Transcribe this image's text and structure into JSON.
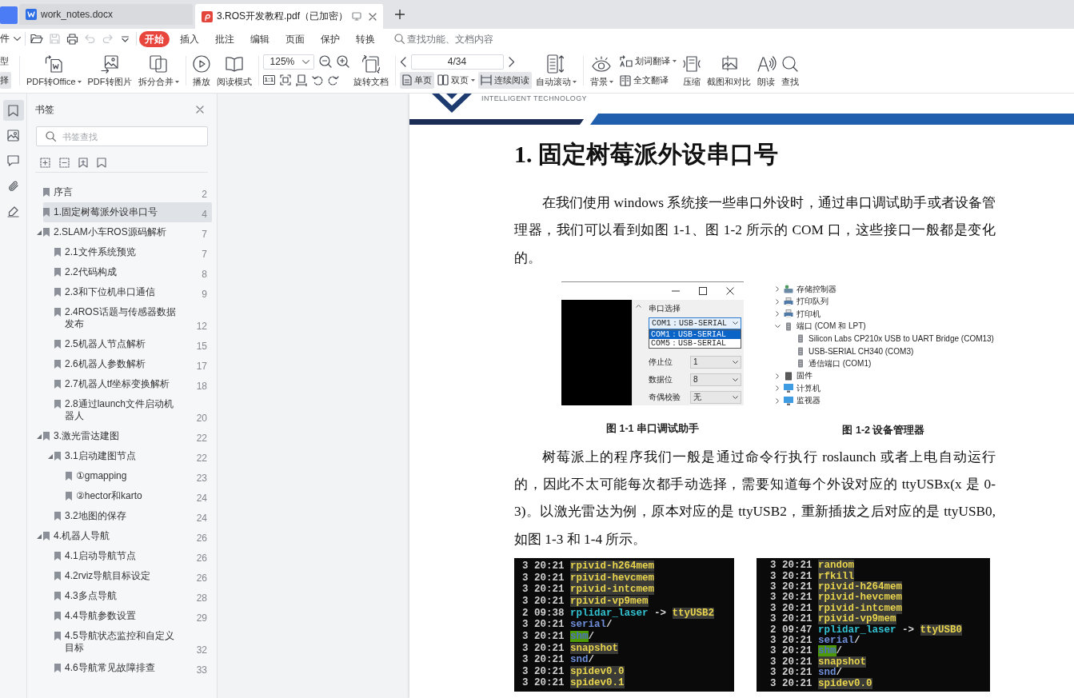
{
  "tabs": [
    {
      "label": "work_notes.docx",
      "kind": "word",
      "selected": false
    },
    {
      "label": "3.ROS开发教程.pdf（已加密）",
      "kind": "pdf",
      "selected": true
    }
  ],
  "menu_bar": {
    "file_menu": "件",
    "quick_access": [
      {
        "disabled": false
      },
      {
        "disabled": true
      },
      {
        "disabled": false
      },
      {
        "disabled": true
      },
      {
        "disabled": true
      },
      {
        "disabled": false
      }
    ],
    "tabs": [
      {
        "label": "开始",
        "selected": true
      },
      {
        "label": "插入",
        "selected": false
      },
      {
        "label": "批注",
        "selected": false
      },
      {
        "label": "编辑",
        "selected": false
      },
      {
        "label": "页面",
        "selected": false
      },
      {
        "label": "保护",
        "selected": false
      },
      {
        "label": "转换",
        "selected": false
      }
    ],
    "search": {
      "placeholder": "查找功能、文档内容"
    }
  },
  "ribbon": {
    "edge_buttons": [
      {
        "label": "型",
        "selected": false
      },
      {
        "label": "择",
        "selected": true
      }
    ],
    "convert": [
      {
        "label": "PDF转Office",
        "dropdown": true
      },
      {
        "label": "PDF转图片",
        "dropdown": false
      },
      {
        "label": "拆分合并",
        "dropdown": true
      }
    ],
    "reading": [
      {
        "label": "播放"
      },
      {
        "label": "阅读模式"
      }
    ],
    "zoom": {
      "value": "125%",
      "actual_size": "1:1"
    },
    "rotate": {
      "label": "旋转文档"
    },
    "page_field": {
      "value": "4/34"
    },
    "view_modes": [
      {
        "label": "单页",
        "selected": true,
        "dropdown": false
      },
      {
        "label": "双页",
        "selected": false,
        "dropdown": true
      },
      {
        "label": "连续阅读",
        "selected": true,
        "dropdown": false
      }
    ],
    "auto_scroll": {
      "label": "自动滚动",
      "dropdown": true
    },
    "tools": [
      {
        "label": "背景",
        "kind": "large",
        "dropdown": true
      },
      {
        "label": "划词翻译",
        "kind": "small",
        "dropdown": true
      },
      {
        "label": "全文翻译",
        "kind": "small",
        "dropdown": false
      },
      {
        "label": "压缩",
        "kind": "large",
        "dropdown": false
      },
      {
        "label": "截图和对比",
        "kind": "large",
        "dropdown": false
      },
      {
        "label": "朗读",
        "kind": "large",
        "dropdown": false
      },
      {
        "label": "查找",
        "kind": "large",
        "dropdown": false
      }
    ]
  },
  "side_rail": [
    {
      "selected": true
    },
    {
      "selected": false
    },
    {
      "selected": false
    },
    {
      "selected": false
    },
    {
      "selected": false
    }
  ],
  "bookmarks": {
    "title": "书签",
    "search": {
      "placeholder": "书签查找"
    },
    "items": [
      {
        "label": "序言",
        "page": "2",
        "selected": false
      },
      {
        "label": "1.固定树莓派外设串口号",
        "page": "4",
        "selected": true
      },
      {
        "label": "2.SLAM小车ROS源码解析",
        "page": "7",
        "selected": false,
        "expanded": true,
        "children": [
          {
            "label": "2.1文件系统预览",
            "page": "7",
            "selected": false
          },
          {
            "label": "2.2代码构成",
            "page": "8",
            "selected": false
          },
          {
            "label": "2.3和下位机串口通信",
            "page": "9",
            "selected": false
          },
          {
            "label": "2.4ROS话题与传感器数据发布",
            "page": "12",
            "selected": false
          },
          {
            "label": "2.5机器人节点解析",
            "page": "15",
            "selected": false
          },
          {
            "label": "2.6机器人参数解析",
            "page": "17",
            "selected": false
          },
          {
            "label": "2.7机器人tf坐标变换解析",
            "page": "18",
            "selected": false
          },
          {
            "label": "2.8通过launch文件启动机器人",
            "page": "20",
            "selected": false
          }
        ]
      },
      {
        "label": "3.激光雷达建图",
        "page": "22",
        "selected": false,
        "expanded": true,
        "children": [
          {
            "label": "3.1启动建图节点",
            "page": "22",
            "selected": false,
            "expanded": true,
            "children": [
              {
                "label": "①gmapping",
                "page": "23",
                "selected": false
              },
              {
                "label": "②hector和karto",
                "page": "24",
                "selected": false
              }
            ]
          },
          {
            "label": "3.2地图的保存",
            "page": "24",
            "selected": false
          }
        ]
      },
      {
        "label": "4.机器人导航",
        "page": "26",
        "selected": false,
        "expanded": true,
        "children": [
          {
            "label": "4.1启动导航节点",
            "page": "26",
            "selected": false
          },
          {
            "label": "4.2rviz导航目标设定",
            "page": "26",
            "selected": false
          },
          {
            "label": "4.3多点导航",
            "page": "28",
            "selected": false
          },
          {
            "label": "4.4导航参数设置",
            "page": "29",
            "selected": false
          },
          {
            "label": "4.5导航状态监控和自定义目标",
            "page": "32",
            "selected": false
          },
          {
            "label": "4.6导航常见故障排查",
            "page": "33",
            "selected": false
          }
        ]
      }
    ]
  },
  "document": {
    "tagline": "INTELLIGENT TECHNOLOGY",
    "heading": "1. 固定树莓派外设串口号",
    "blocks": [
      {
        "kind": "paragraph",
        "text": "在我们使用 windows 系统接一些串口外设时，通过串口调试助手或者设备管理器，我们可以看到如图 1-1、图 1-2 所示的 COM 口，这些接口一般都是变化的。"
      },
      {
        "kind": "figures",
        "figures": [
          {
            "kind": "serial_tool",
            "caption": "图 1-1 串口调试助手",
            "port_label": "串口选择",
            "port_value": "COM1：USB-SERIAL",
            "port_options": [
              {
                "label": "COM1：USB-SERIAL",
                "selected": true
              },
              {
                "label": "COM5：USB-SERIAL",
                "selected": false
              }
            ],
            "fields": [
              {
                "label": "停止位",
                "value": "1"
              },
              {
                "label": "数据位",
                "value": "8"
              },
              {
                "label": "奇偶校验",
                "value": "无"
              }
            ]
          },
          {
            "kind": "device_manager",
            "caption": "图 1-2 设备管理器",
            "items": [
              {
                "label": "存储控制器",
                "expanded": false
              },
              {
                "label": "打印队列",
                "expanded": false
              },
              {
                "label": "打印机",
                "expanded": false
              },
              {
                "label": "端口 (COM 和 LPT)",
                "expanded": true,
                "children": [
                  {
                    "label": "Silicon Labs CP210x USB to UART Bridge (COM13)"
                  },
                  {
                    "label": "USB-SERIAL CH340 (COM3)"
                  },
                  {
                    "label": "通信端口 (COM1)"
                  }
                ]
              },
              {
                "label": "固件",
                "expanded": false
              },
              {
                "label": "计算机",
                "expanded": false
              },
              {
                "label": "监视器",
                "expanded": false
              }
            ]
          }
        ]
      },
      {
        "kind": "paragraph",
        "text": "树莓派上的程序我们一般是通过命令行执行 roslaunch 或者上电自动运行的，因此不太可能每次都手动选择，需要知道每个外设对应的 ttyUSBx(x 是 0-3)。以激光雷达为例，原本对应的是 ttyUSB2，重新插拔之后对应的是 ttyUSB0,如图 1-3 和 1-4 所示。"
      },
      {
        "kind": "terminals",
        "terminals": [
          {
            "lines": [
              {
                "count": "3",
                "time": "20:21",
                "name": "rpivid-h264mem",
                "kind": "device"
              },
              {
                "count": "3",
                "time": "20:21",
                "name": "rpivid-hevcmem",
                "kind": "device"
              },
              {
                "count": "3",
                "time": "20:21",
                "name": "rpivid-intcmem",
                "kind": "device"
              },
              {
                "count": "3",
                "time": "20:21",
                "name": "rpivid-vp9mem",
                "kind": "device"
              },
              {
                "count": "2",
                "time": "09:38",
                "name": "rplidar_laser",
                "kind": "link",
                "arrow": "->",
                "target": "ttyUSB2"
              },
              {
                "count": "3",
                "time": "20:21",
                "name": "serial",
                "kind": "dir",
                "suffix": "/"
              },
              {
                "count": "3",
                "time": "20:21",
                "name": "shm",
                "kind": "sticky",
                "suffix": "/"
              },
              {
                "count": "3",
                "time": "20:21",
                "name": "snapshot",
                "kind": "device"
              },
              {
                "count": "3",
                "time": "20:21",
                "name": "snd",
                "kind": "dir",
                "suffix": "/"
              },
              {
                "count": "3",
                "time": "20:21",
                "name": "spidev0.0",
                "kind": "device"
              },
              {
                "count": "3",
                "time": "20:21",
                "name": "spidev0.1",
                "kind": "device"
              }
            ]
          },
          {
            "lines": [
              {
                "count": "3",
                "time": "20:21",
                "name": "random",
                "kind": "device"
              },
              {
                "count": "3",
                "time": "20:21",
                "name": "rfkill",
                "kind": "device"
              },
              {
                "count": "3",
                "time": "20:21",
                "name": "rpivid-h264mem",
                "kind": "device"
              },
              {
                "count": "3",
                "time": "20:21",
                "name": "rpivid-hevcmem",
                "kind": "device"
              },
              {
                "count": "3",
                "time": "20:21",
                "name": "rpivid-intcmem",
                "kind": "device"
              },
              {
                "count": "3",
                "time": "20:21",
                "name": "rpivid-vp9mem",
                "kind": "device"
              },
              {
                "count": "2",
                "time": "09:47",
                "name": "rplidar_laser",
                "kind": "link",
                "arrow": "->",
                "target": "ttyUSB0"
              },
              {
                "count": "3",
                "time": "20:21",
                "name": "serial",
                "kind": "dir",
                "suffix": "/"
              },
              {
                "count": "3",
                "time": "20:21",
                "name": "shm",
                "kind": "sticky",
                "suffix": "/"
              },
              {
                "count": "3",
                "time": "20:21",
                "name": "snapshot",
                "kind": "device"
              },
              {
                "count": "3",
                "time": "20:21",
                "name": "snd",
                "kind": "dir",
                "suffix": "/"
              },
              {
                "count": "3",
                "time": "20:21",
                "name": "spidev0.0",
                "kind": "device"
              }
            ]
          }
        ]
      }
    ]
  }
}
